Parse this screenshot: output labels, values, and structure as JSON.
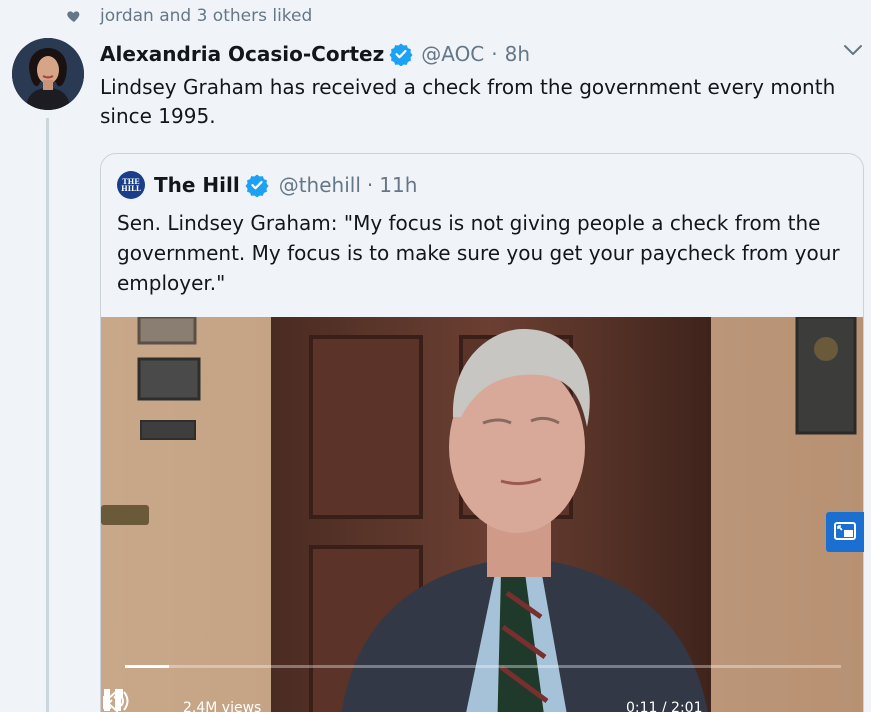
{
  "social_context": {
    "liked_text": "jordan and 3 others liked"
  },
  "tweet": {
    "author_name": "Alexandria Ocasio-Cortez",
    "handle": "@AOC",
    "separator": "·",
    "time": "8h",
    "text": "Lindsey Graham has received a check from the government every month since 1995."
  },
  "quoted_tweet": {
    "avatar_text": "THE HILL",
    "author_name": "The Hill",
    "handle": "@thehill",
    "separator": "·",
    "time": "11h",
    "text": "Sen. Lindsey Graham: \"My focus is not giving people a check from the government. My focus is to make sure you get your paycheck from your employer.\""
  },
  "video": {
    "progress_fraction": 0.062,
    "view_count": "2.4M views",
    "time_readout": "0:11 / 2:01"
  },
  "colors": {
    "background": "#f0f4f8",
    "verified": "#1da1f2",
    "secondary_text": "#657786",
    "pip_button": "#1a6fd0"
  },
  "icons": [
    "heart-icon",
    "verified-icon",
    "chevron-down-icon",
    "picture-in-picture-icon",
    "pause-icon",
    "volume-icon",
    "expand-icon"
  ]
}
